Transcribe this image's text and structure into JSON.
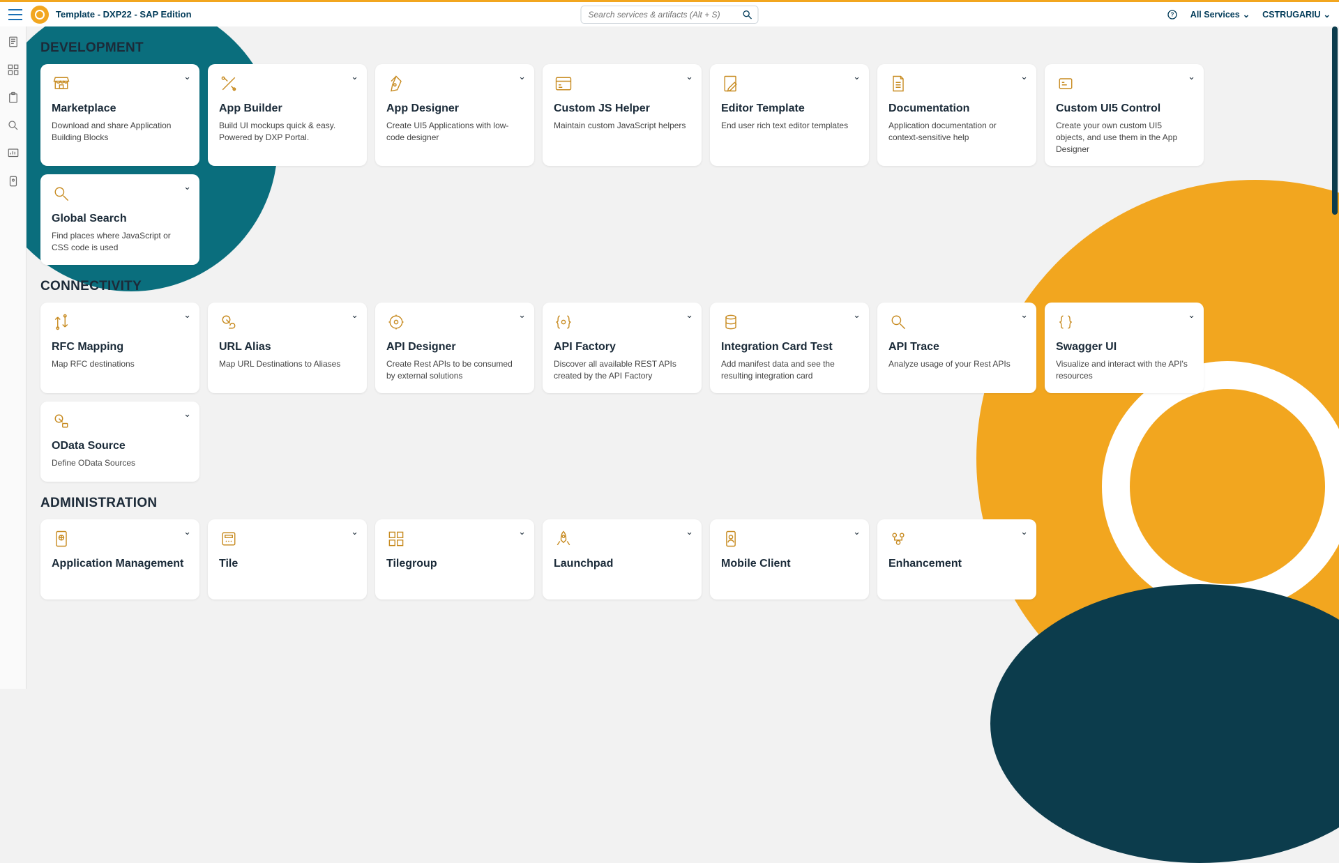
{
  "header": {
    "title": "Template  - DXP22 - SAP Edition",
    "search_placeholder": "Search services & artifacts (Alt + S)",
    "all_services_label": "All Services",
    "user_label": "CSTRUGARIU"
  },
  "sections": [
    {
      "title": "DEVELOPMENT",
      "cards": [
        {
          "icon": "store",
          "title": "Marketplace",
          "desc": "Download and share Application Building Blocks"
        },
        {
          "icon": "tools",
          "title": "App Builder",
          "desc": "Build UI mockups quick & easy. Powered by DXP Portal."
        },
        {
          "icon": "pen-nib",
          "title": "App Designer",
          "desc": "Create UI5 Applications with low-code designer"
        },
        {
          "icon": "js-brackets",
          "title": "Custom JS Helper",
          "desc": "Maintain custom JavaScript helpers"
        },
        {
          "icon": "edit-doc",
          "title": "Editor Template",
          "desc": "End user rich text editor templates"
        },
        {
          "icon": "doc-lines",
          "title": "Documentation",
          "desc": "Application documentation or context-sensitive help"
        },
        {
          "icon": "control-box",
          "title": "Custom UI5 Control",
          "desc": "Create your own custom UI5 objects, and use them in the App Designer"
        },
        {
          "icon": "magnify",
          "title": "Global Search",
          "desc": "Find places where JavaScript or CSS code is used"
        }
      ]
    },
    {
      "title": "CONNECTIVITY",
      "cards": [
        {
          "icon": "arrows-ud",
          "title": "RFC Mapping",
          "desc": "Map RFC destinations"
        },
        {
          "icon": "cloud-link",
          "title": "URL Alias",
          "desc": "Map URL Destinations to Aliases"
        },
        {
          "icon": "circle-gear",
          "title": "API Designer",
          "desc": "Create Rest APIs to be consumed by external solutions"
        },
        {
          "icon": "curly-gear",
          "title": "API Factory",
          "desc": "Discover all available REST APIs created by the API Factory"
        },
        {
          "icon": "db-stack",
          "title": "Integration Card Test",
          "desc": "Add manifest data and see the resulting integration card"
        },
        {
          "icon": "magnify",
          "title": "API Trace",
          "desc": "Analyze usage of your Rest APIs"
        },
        {
          "icon": "curly",
          "title": "Swagger UI",
          "desc": "Visualize and interact with the API's resources"
        },
        {
          "icon": "cloud-db",
          "title": "OData Source",
          "desc": "Define OData Sources"
        }
      ]
    },
    {
      "title": "ADMINISTRATION",
      "cards": [
        {
          "icon": "tablet-globe",
          "title": "Application Management",
          "desc": ""
        },
        {
          "icon": "tile-one",
          "title": "Tile",
          "desc": ""
        },
        {
          "icon": "tile-grid",
          "title": "Tilegroup",
          "desc": ""
        },
        {
          "icon": "rocket",
          "title": "Launchpad",
          "desc": ""
        },
        {
          "icon": "phone-user",
          "title": "Mobile Client",
          "desc": ""
        },
        {
          "icon": "gears-flow",
          "title": "Enhancement",
          "desc": ""
        }
      ]
    }
  ]
}
